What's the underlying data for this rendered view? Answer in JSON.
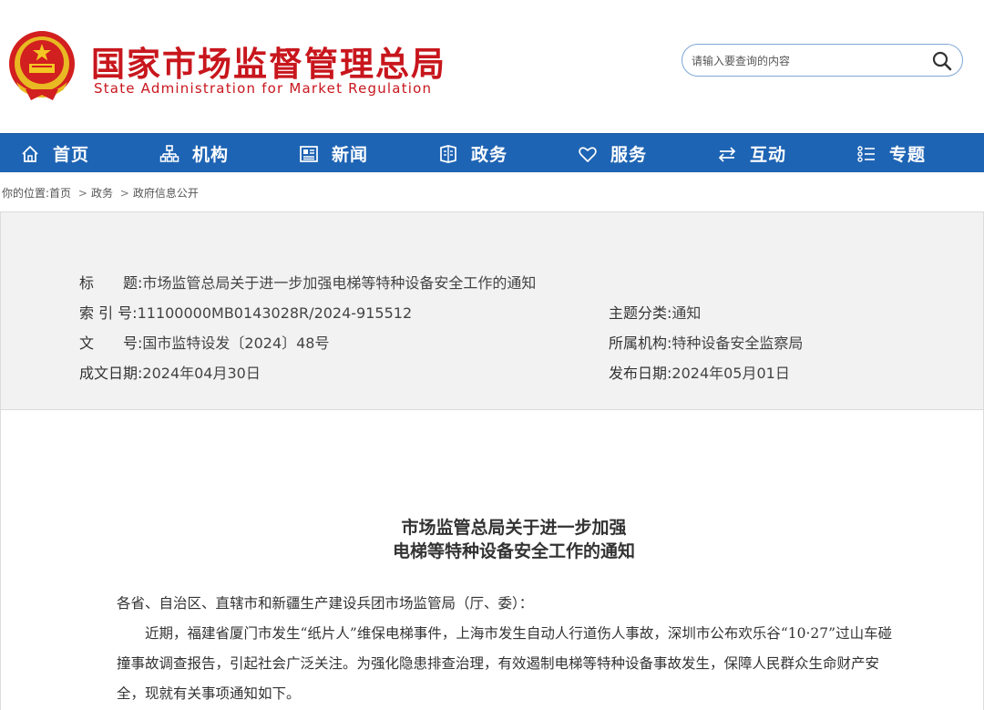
{
  "header": {
    "brand_cn": "国家市场监督管理总局",
    "brand_en": "State Administration for Market Regulation",
    "emblem_icon": "national-emblem-icon",
    "brand_color": "#c8161d"
  },
  "search": {
    "placeholder": "请输入要查询的内容",
    "icon": "search-icon"
  },
  "nav": {
    "background": "#1e64b4",
    "items": [
      {
        "label": "首页",
        "icon": "home-icon"
      },
      {
        "label": "机构",
        "icon": "org-chart-icon"
      },
      {
        "label": "新闻",
        "icon": "news-icon"
      },
      {
        "label": "政务",
        "icon": "government-affairs-icon"
      },
      {
        "label": "服务",
        "icon": "heart-icon"
      },
      {
        "label": "互动",
        "icon": "exchange-arrows-icon"
      },
      {
        "label": "专题",
        "icon": "topics-list-icon"
      }
    ]
  },
  "breadcrumb": {
    "prefix": "你的位置:",
    "items": [
      "首页",
      "政务",
      "政府信息公开"
    ],
    "separator": ">"
  },
  "info": {
    "title_label": "标　　题:",
    "title_value": "市场监管总局关于进一步加强电梯等特种设备安全工作的通知",
    "index_label": "索 引 号:",
    "index_value": "11100000MB0143028R/2024-915512",
    "category_label": "主题分类:",
    "category_value": "通知",
    "doc_no_label": "文　　号:",
    "doc_no_value": "国市监特设发〔2024〕48号",
    "agency_label": "所属机构:",
    "agency_value": "特种设备安全监察局",
    "written_date_label": "成文日期:",
    "written_date_value": "2024年04月30日",
    "publish_date_label": "发布日期:",
    "publish_date_value": "2024年05月01日"
  },
  "document": {
    "title_line1": "市场监管总局关于进一步加强",
    "title_line2": "电梯等特种设备安全工作的通知",
    "salutation": "各省、自治区、直辖市和新疆生产建设兵团市场监管局（厅、委）：",
    "paragraph1": "近期，福建省厦门市发生“纸片人”维保电梯事件，上海市发生自动人行道伤人事故，深圳市公布欢乐谷“10·27”过山车碰撞事故调查报告，引起社会广泛关注。为强化隐患排查治理，有效遏制电梯等特种设备事故发生，保障人民群众生命财产安全，现就有关事项通知如下。"
  }
}
